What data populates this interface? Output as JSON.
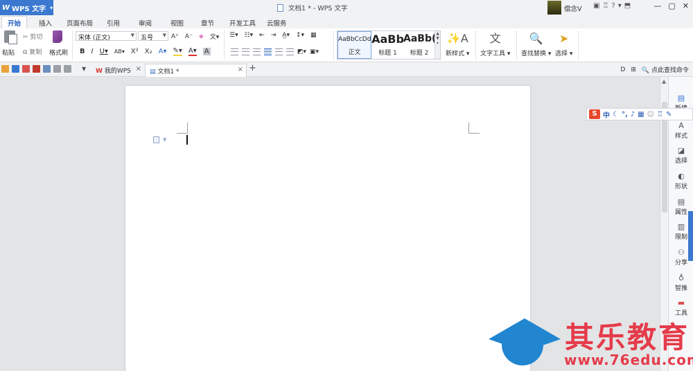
{
  "titlebar": {
    "app_menu": "WPS 文字",
    "window_title": "文档1 * - WPS 文字",
    "user_name": "偿念V",
    "help": "?"
  },
  "tabs": [
    "开始",
    "插入",
    "页面布局",
    "引用",
    "审阅",
    "视图",
    "章节",
    "开发工具",
    "云服务"
  ],
  "ribbon": {
    "cut": "剪切",
    "copy": "复制",
    "paste": "粘贴",
    "format_painter": "格式刷",
    "font_name": "宋体 (正文)",
    "font_size": "五号",
    "styles": [
      {
        "sample": "AaBbCcDd",
        "label": "正文"
      },
      {
        "sample": "AaBb",
        "label": "标题 1"
      },
      {
        "sample": "AaBb(",
        "label": "标题 2"
      }
    ],
    "new_style": "新样式",
    "text_tools": "文字工具",
    "find_replace": "查找替换",
    "select": "选择"
  },
  "quickbar": {
    "doc_tabs": [
      {
        "label": "我的WPS"
      },
      {
        "label": "文档1 *"
      }
    ],
    "search_command": "点此查找命令"
  },
  "taskpane": [
    {
      "label": "新建",
      "icon": "new-doc-icon"
    },
    {
      "label": "样式",
      "icon": "style-icon"
    },
    {
      "label": "选择",
      "icon": "select-icon"
    },
    {
      "label": "形状",
      "icon": "shape-icon"
    },
    {
      "label": "属性",
      "icon": "property-icon"
    },
    {
      "label": "限制",
      "icon": "restrict-icon"
    },
    {
      "label": "分享",
      "icon": "share-icon"
    },
    {
      "label": "智推",
      "icon": "bulb-icon"
    },
    {
      "label": "工具",
      "icon": "toolbox-icon"
    }
  ],
  "ime": {
    "brand": "S",
    "mode": "中"
  },
  "watermark": {
    "name": "其乐教育",
    "url": "www.76edu.com"
  },
  "colors": {
    "accent": "#3b78d0",
    "watermark_red": "#e53b4a",
    "watermark_blue": "#2185d0"
  }
}
